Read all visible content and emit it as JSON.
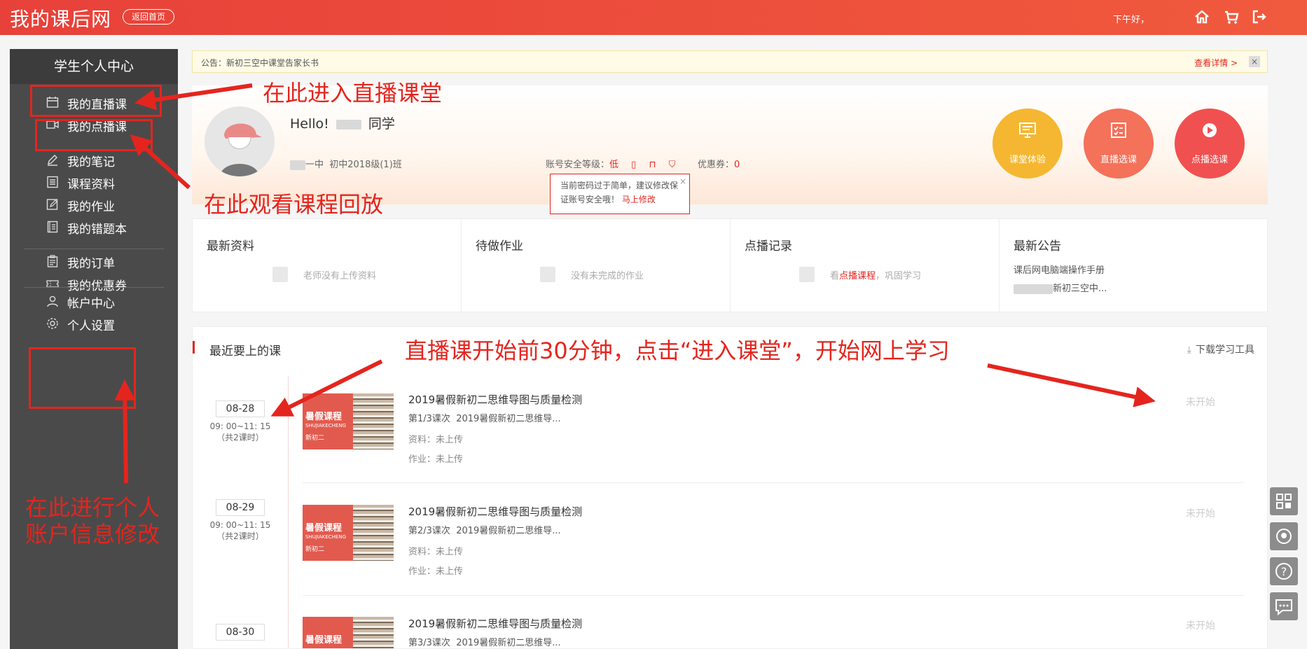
{
  "header": {
    "brand": "我的课后网",
    "back_home": "返回首页",
    "greeting": "下午好，"
  },
  "sidebar": {
    "title": "学生个人中心",
    "items": [
      {
        "label": "我的直播课",
        "icon": "calendar-icon"
      },
      {
        "label": "我的点播课",
        "icon": "video-icon"
      },
      {
        "label": "我的笔记",
        "icon": "pencil-icon"
      },
      {
        "label": "课程资料",
        "icon": "document-icon"
      },
      {
        "label": "我的作业",
        "icon": "edit-icon"
      },
      {
        "label": "我的错题本",
        "icon": "notebook-icon"
      },
      {
        "label": "我的订单",
        "icon": "clipboard-icon"
      },
      {
        "label": "我的优惠券",
        "icon": "ticket-icon"
      },
      {
        "label": "帐户中心",
        "icon": "user-icon"
      },
      {
        "label": "个人设置",
        "icon": "gear-icon"
      }
    ]
  },
  "annotations": {
    "live": "在此进入直播课堂",
    "replay": "在此观看课程回放",
    "account": "在此进行个人账户信息修改",
    "enter_class": "直播课开始前30分钟，点击“进入课堂”，开始网上学习"
  },
  "notice": {
    "text": "公告：新初三空中课堂告家长书",
    "more": "查看详情 >",
    "close": "×"
  },
  "profile": {
    "hello": "Hello!",
    "student_suffix": "同学",
    "school": "一中",
    "class_name": "初中2018级(1)班",
    "security_label": "账号安全等级：",
    "security_level": "低",
    "coupon_label": "优惠券：",
    "coupon_count": "0",
    "buttons": [
      {
        "label": "课堂体验",
        "color": "#f5b731"
      },
      {
        "label": "直播选课",
        "color": "#f4715a"
      },
      {
        "label": "点播选课",
        "color": "#f15050"
      }
    ],
    "tip_text": "当前密码过于简单，建议修改保证账号安全哦！",
    "tip_link": "马上修改",
    "tip_close": "×"
  },
  "panels": [
    {
      "title": "最新资料",
      "empty": "老师没有上传资料"
    },
    {
      "title": "待做作业",
      "empty": "没有未完成的作业"
    },
    {
      "title": "点播记录",
      "empty_pre": "看",
      "empty_link": "点播课程",
      "empty_post": "，巩固学习"
    },
    {
      "title": "最新公告",
      "lines": [
        "课后网电脑端操作手册",
        "新初三空中..."
      ]
    }
  ],
  "courses": {
    "title": "最近要上的课",
    "download": "下载学习工具",
    "thumb_title": "暑假课程",
    "thumb_sub": "SHUJIAKECHENG",
    "thumb_grade": "新初二",
    "rows": [
      {
        "date": "08-28",
        "time": "09: 00~11: 15",
        "count": "（共2课时）",
        "name": "2019暑假新初二思维导图与质量检测",
        "lesson": "第1/3课次",
        "lesson_name": "2019暑假新初二思维导...",
        "material": "资料：未上传",
        "homework": "作业：未上传",
        "status": "未开始"
      },
      {
        "date": "08-29",
        "time": "09: 00~11: 15",
        "count": "（共2课时）",
        "name": "2019暑假新初二思维导图与质量检测",
        "lesson": "第2/3课次",
        "lesson_name": "2019暑假新初二思维导...",
        "material": "资料：未上传",
        "homework": "作业：未上传",
        "status": "未开始"
      },
      {
        "date": "08-30",
        "time": "",
        "count": "",
        "name": "2019暑假新初二思维导图与质量检测",
        "lesson": "第3/3课次",
        "lesson_name": "2019暑假新初二思维导...",
        "material": "",
        "homework": "",
        "status": "未开始"
      }
    ]
  }
}
